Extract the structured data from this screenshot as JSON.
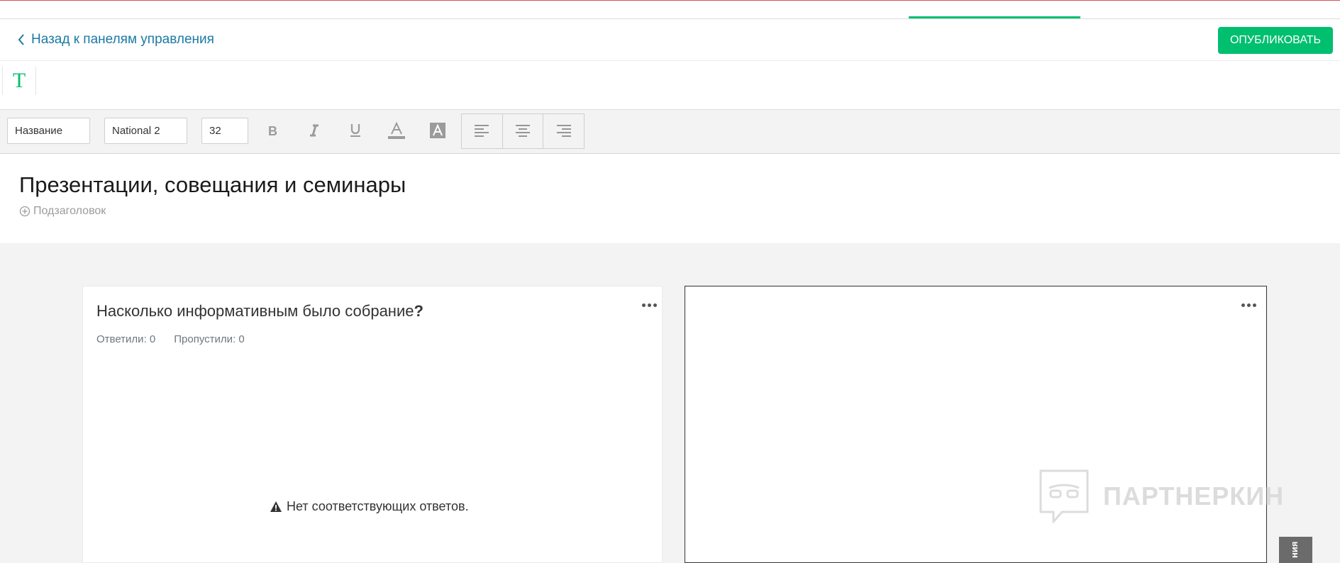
{
  "header": {
    "back_label": "Назад к панелям управления",
    "publish_label": "ОПУБЛИКОВАТЬ"
  },
  "tools": {
    "text_tool_glyph": "T"
  },
  "format_bar": {
    "style_value": "Название",
    "font_value": "National 2",
    "size_value": "32"
  },
  "title_area": {
    "title": "Презентации, совещания и семинары",
    "subtitle_add": "Подзаголовок"
  },
  "question_card": {
    "title": "Насколько информативным было собрание",
    "title_suffix": "?",
    "answered": "Ответили: 0",
    "skipped": "Пропустили: 0",
    "empty_message": "Нет соответствующих ответов."
  },
  "watermark": {
    "text": "ПАРТНЕРКИН"
  },
  "side_tab": {
    "label": "ния"
  },
  "colors": {
    "accent": "#00bf6f",
    "link": "#1b7aa3"
  }
}
